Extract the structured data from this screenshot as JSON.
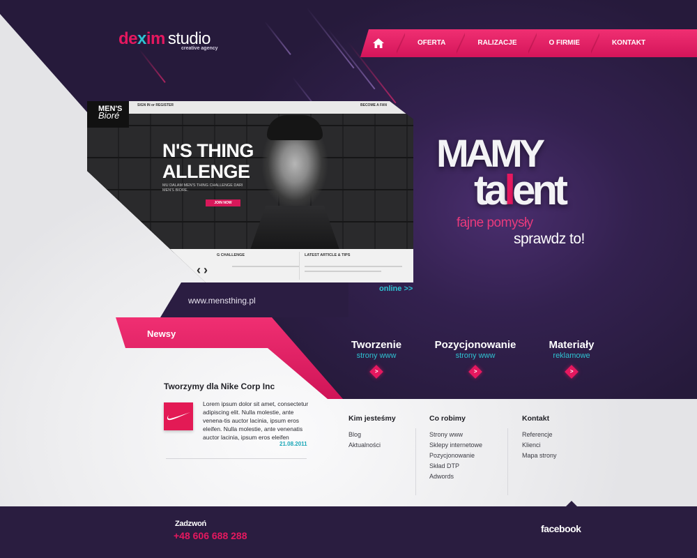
{
  "brand": {
    "part_d": "de",
    "part_x": "x",
    "part_im": "im",
    "part_studio": "studio",
    "tagline": "creative agency"
  },
  "nav": {
    "home_icon": "home-icon",
    "items": [
      "OFERTA",
      "RALIZACJE",
      "O FIRMIE",
      "KONTAKT"
    ]
  },
  "showcase": {
    "sign_in": "SIGN IN or REGISTER",
    "become_fan": "BECOME A FAN",
    "logo_top": "MEN'S",
    "logo_bottom": "Bioré",
    "headline_1": "N'S THING",
    "headline_2": "ALLENGE",
    "subline": "MU DALAM MEN'S THING CHALLENGE DARI MEN'S BIORE.",
    "join": "JOIN NOW",
    "col1": "G CHALLENGE",
    "col2": "LATEST ARTICLE & TIPS",
    "prev": "‹",
    "next": "›",
    "online": "online >>",
    "url": "www.mensthing.pl"
  },
  "hero": {
    "line1": "MAMY",
    "line2_a": "ta",
    "line2_b": "l",
    "line2_c": "ent",
    "sub1": "fajne pomysły",
    "sub2": "sprawdz to!"
  },
  "services": [
    {
      "title": "Tworzenie",
      "sub": "strony www",
      "button": ">"
    },
    {
      "title": "Pozycjonowanie",
      "sub": "strony www",
      "button": ">"
    },
    {
      "title": "Materiały",
      "sub": "reklamowe",
      "button": ">"
    }
  ],
  "news": {
    "section_title": "Newsy",
    "headline": "Tworzymy dla Nike Corp Inc",
    "body": "Lorem ipsum dolor sit amet, consectetur adipiscing elit. Nulla molestie, ante venena-tis auctor lacinia, ipsum eros eleifen. Nulla molestie, ante venenatis auctor lacinia, ipsum eros eleifen",
    "date": "21.08.2011",
    "logo_icon": "nike-swoosh-icon"
  },
  "footer_columns": [
    {
      "heading": "Kim jesteśmy",
      "links": [
        "Blog",
        "Aktualności"
      ]
    },
    {
      "heading": "Co robimy",
      "links": [
        "Strony www",
        "Sklepy internetowe",
        "Pozycjonowanie",
        "Skład DTP",
        "Adwords"
      ]
    },
    {
      "heading": "Kontakt",
      "links": [
        "Referencje",
        "Klienci",
        "Mapa strony"
      ]
    }
  ],
  "bottom_bar": {
    "call_label": "Zadzwoń",
    "phone": "+48 606 688 288",
    "facebook": "facebook"
  },
  "colors": {
    "accent_pink": "#e5185f",
    "accent_cyan": "#2ec2d2",
    "dark_purple": "#2a1d40",
    "light_bg": "#ececee"
  }
}
